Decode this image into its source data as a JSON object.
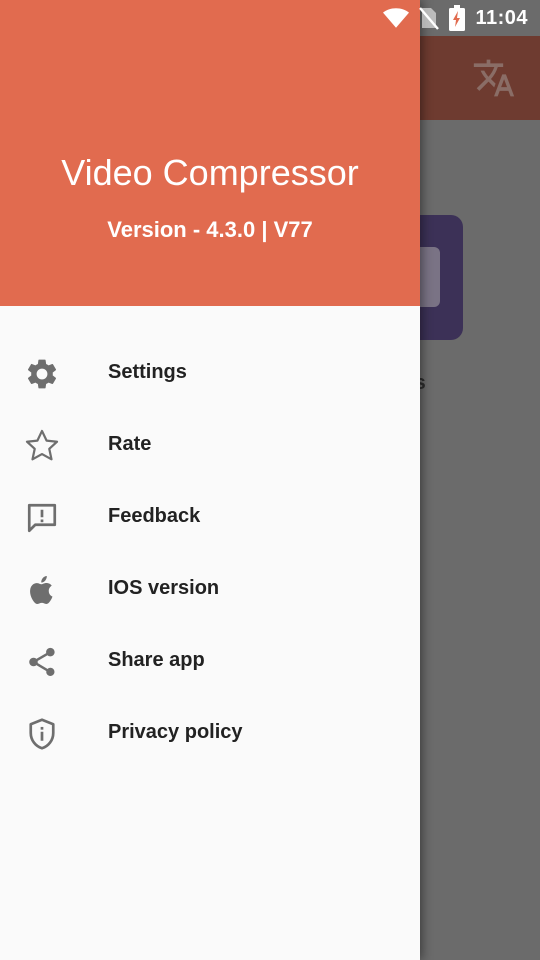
{
  "status_bar": {
    "time": "11:04",
    "icons": [
      "wifi-icon",
      "no-sim-icon",
      "battery-charging-icon"
    ]
  },
  "app": {
    "toolbar_icon": "translate-icon",
    "background_label_fragment": "ts"
  },
  "drawer": {
    "title": "Video Compressor",
    "subtitle": "Version - 4.3.0 | V77",
    "items": [
      {
        "icon": "gear-icon",
        "label": "Settings"
      },
      {
        "icon": "star-outline-icon",
        "label": "Rate"
      },
      {
        "icon": "feedback-icon",
        "label": "Feedback"
      },
      {
        "icon": "apple-icon",
        "label": "IOS version"
      },
      {
        "icon": "share-icon",
        "label": "Share app"
      },
      {
        "icon": "shield-info-icon",
        "label": "Privacy policy"
      }
    ]
  },
  "colors": {
    "header": "#e16b4f",
    "drawer_bg": "#fafafa",
    "scrim": "#6b6b6b",
    "icon": "#6e6e6e",
    "text": "#222222"
  }
}
